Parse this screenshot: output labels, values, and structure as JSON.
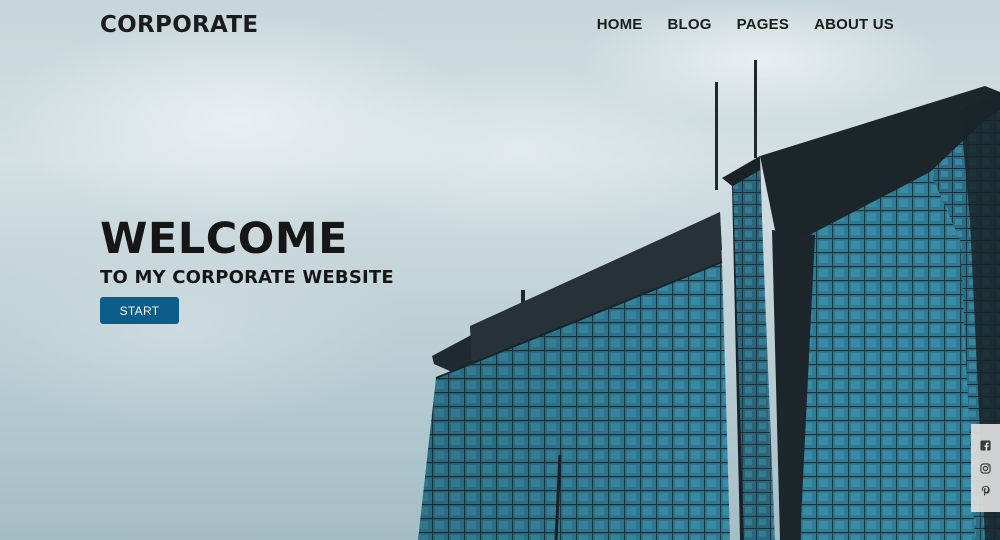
{
  "brand": {
    "logo_text": "CORPORATE"
  },
  "nav": {
    "items": [
      "HOME",
      "BLOG",
      "PAGES",
      "ABOUT US"
    ]
  },
  "hero": {
    "title": "WELCOME",
    "subtitle": "TO MY CORPORATE WEBSITE",
    "cta_label": "START"
  },
  "social": {
    "icons": [
      "facebook-icon",
      "instagram-icon",
      "pinterest-icon"
    ]
  },
  "colors": {
    "accent": "#0d5d8a",
    "text": "#161616"
  }
}
